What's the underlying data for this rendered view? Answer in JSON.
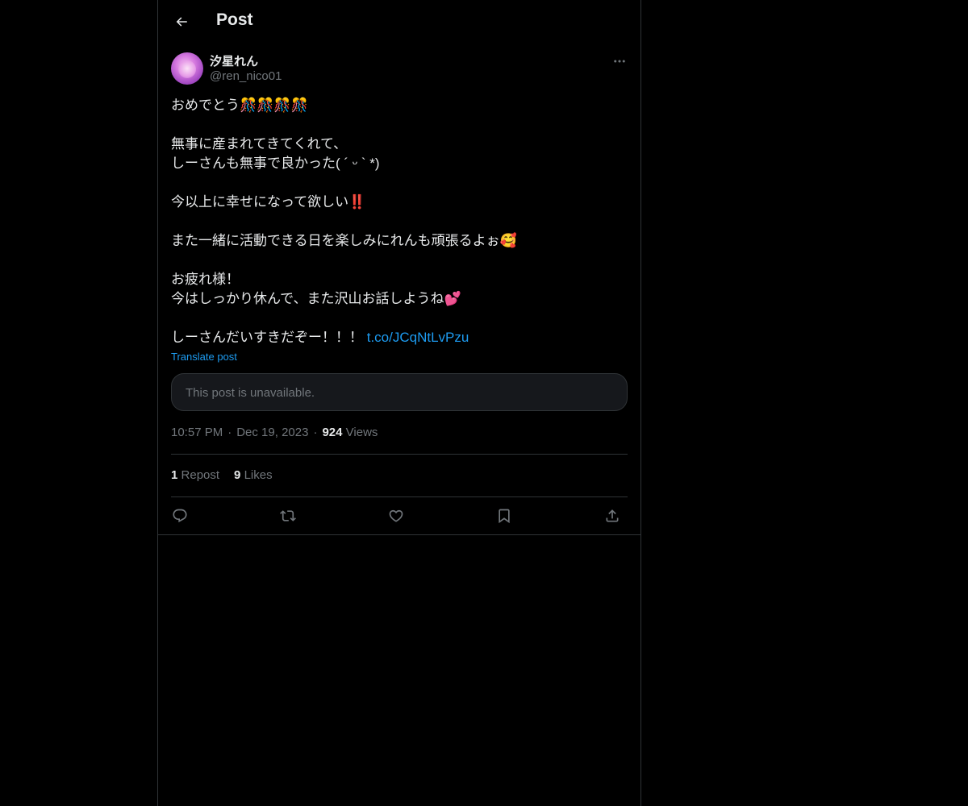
{
  "header": {
    "title": "Post"
  },
  "author": {
    "display_name": "汐星れん",
    "handle": "@ren_nico01"
  },
  "tweet": {
    "lines": [
      "おめでとう🎊🎊🎊🎊",
      "",
      "無事に産まれてきてくれて、",
      "しーさんも無事で良かった( ´ ᵕ ` *)",
      "",
      "今以上に幸せになって欲しい",
      "",
      "また一緒に活動できる日を楽しみにれんも頑張るよぉ🥰",
      "",
      "お疲れ様！",
      "今はしっかり休んで、また沢山お話しようね💕",
      "",
      "しーさんだいすきだぞー！！！ "
    ],
    "exclaim_emoji": "‼️",
    "link": "t.co/JCqNtLvPzu",
    "translate_label": "Translate post"
  },
  "quote": {
    "text": "This post is unavailable."
  },
  "meta": {
    "time": "10:57 PM",
    "date": "Dec 19, 2023",
    "views_count": "924",
    "views_label": "Views",
    "separator": "·"
  },
  "stats": {
    "reposts_count": "1",
    "reposts_label": "Repost",
    "likes_count": "9",
    "likes_label": "Likes"
  },
  "icons": {
    "back": "back-arrow-icon",
    "more": "more-icon",
    "reply": "reply-icon",
    "repost": "repost-icon",
    "like": "like-icon",
    "bookmark": "bookmark-icon",
    "share": "share-icon"
  },
  "colors": {
    "background": "#000000",
    "text": "#e7e9ea",
    "secondary": "#71767b",
    "accent": "#1d9bf0",
    "border": "#2f3336"
  }
}
